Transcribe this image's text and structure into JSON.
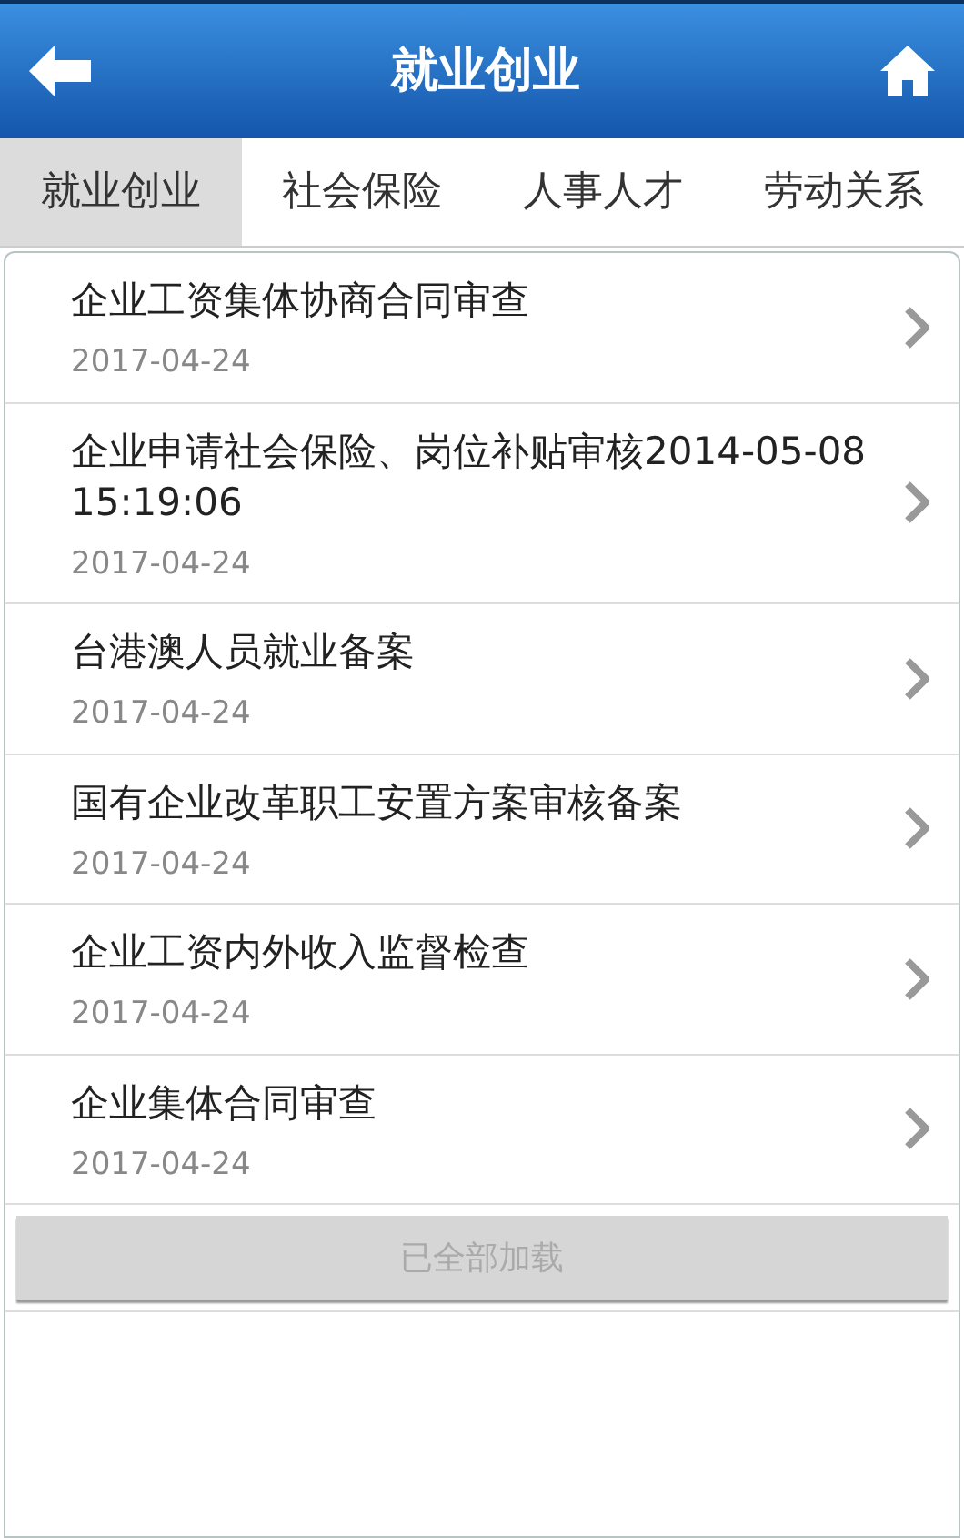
{
  "header": {
    "title": "就业创业"
  },
  "tabs": [
    {
      "label": "就业创业",
      "selected": true
    },
    {
      "label": "社会保险",
      "selected": false
    },
    {
      "label": "人事人才",
      "selected": false
    },
    {
      "label": "劳动关系",
      "selected": false
    }
  ],
  "items": [
    {
      "title": "企业工资集体协商合同审查",
      "date": "2017-04-24"
    },
    {
      "title": "企业申请社会保险、岗位补贴审核2014-05-08 15:19:06",
      "date": "2017-04-24"
    },
    {
      "title": "台港澳人员就业备案",
      "date": "2017-04-24"
    },
    {
      "title": "国有企业改革职工安置方案审核备案",
      "date": "2017-04-24"
    },
    {
      "title": "企业工资内外收入监督检查",
      "date": "2017-04-24"
    },
    {
      "title": "企业集体合同审查",
      "date": "2017-04-24"
    }
  ],
  "load_button": {
    "label": "已全部加载",
    "disabled": true
  }
}
